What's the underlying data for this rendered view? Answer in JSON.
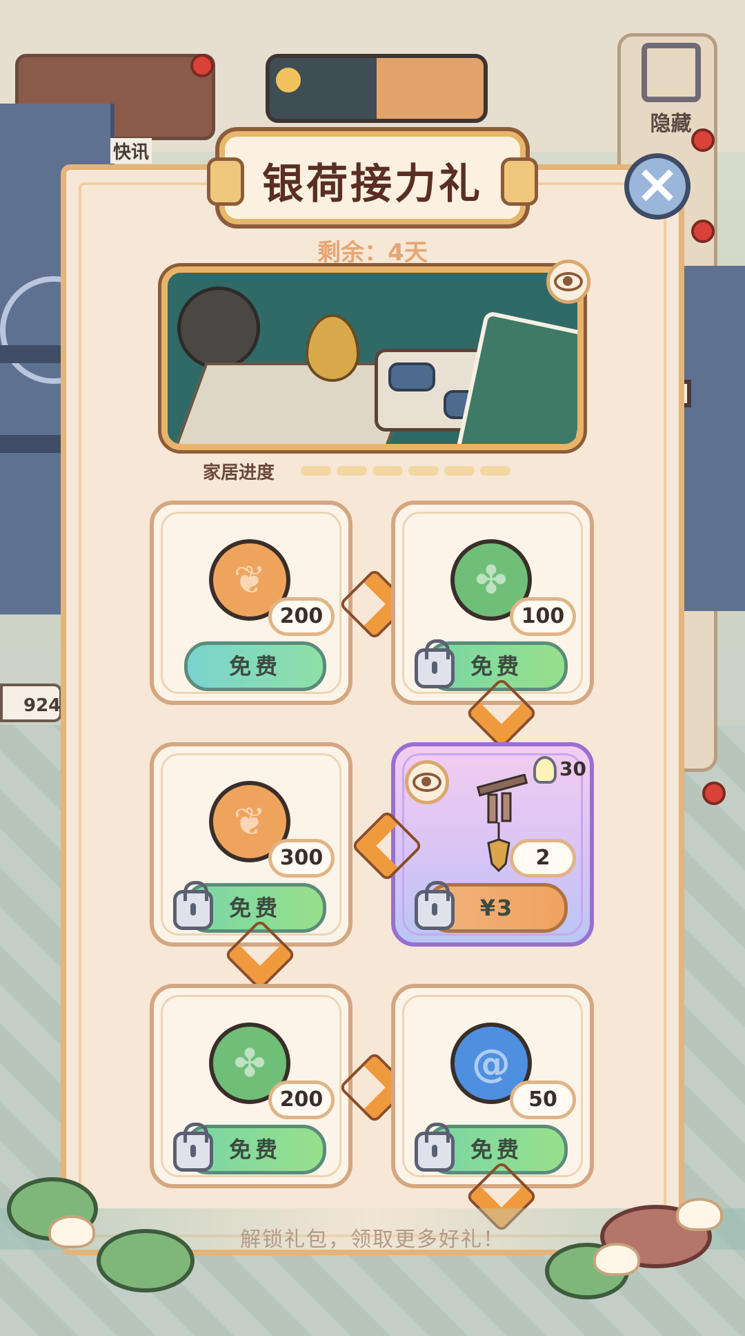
{
  "hud": {
    "news_label": "快讯",
    "hide_label": "隐藏",
    "coin_count": "924"
  },
  "dialog": {
    "title": "银荷接力礼",
    "remaining": "剩余：4天",
    "progress_label": "家居进度",
    "progress_segments": 6,
    "footer": "解锁礼包，领取更多好礼！"
  },
  "cards": [
    {
      "currency": "orange-leaf-coin",
      "quantity": "200",
      "button": "免费",
      "locked": false
    },
    {
      "currency": "green-leaf-coin",
      "quantity": "100",
      "button": "免费",
      "locked": true
    },
    {
      "currency": "wind-chime-furniture",
      "quantity": "2",
      "button": "¥3",
      "locked": true,
      "bulb_points": "30"
    },
    {
      "currency": "orange-leaf-coin",
      "quantity": "300",
      "button": "免费",
      "locked": true
    },
    {
      "currency": "green-leaf-coin",
      "quantity": "200",
      "button": "免费",
      "locked": true
    },
    {
      "currency": "blue-swirl-coin",
      "quantity": "50",
      "button": "免费",
      "locked": true
    }
  ],
  "colors": {
    "dialog_bg": "#f7e7d6",
    "frame_gold": "#e3b57a",
    "title_brown": "#5a2e22",
    "free_button": "#8fe0a6",
    "paid_button": "#f0a362",
    "special_card": "#d8c4f5",
    "arrow_orange": "#f09a3e"
  }
}
